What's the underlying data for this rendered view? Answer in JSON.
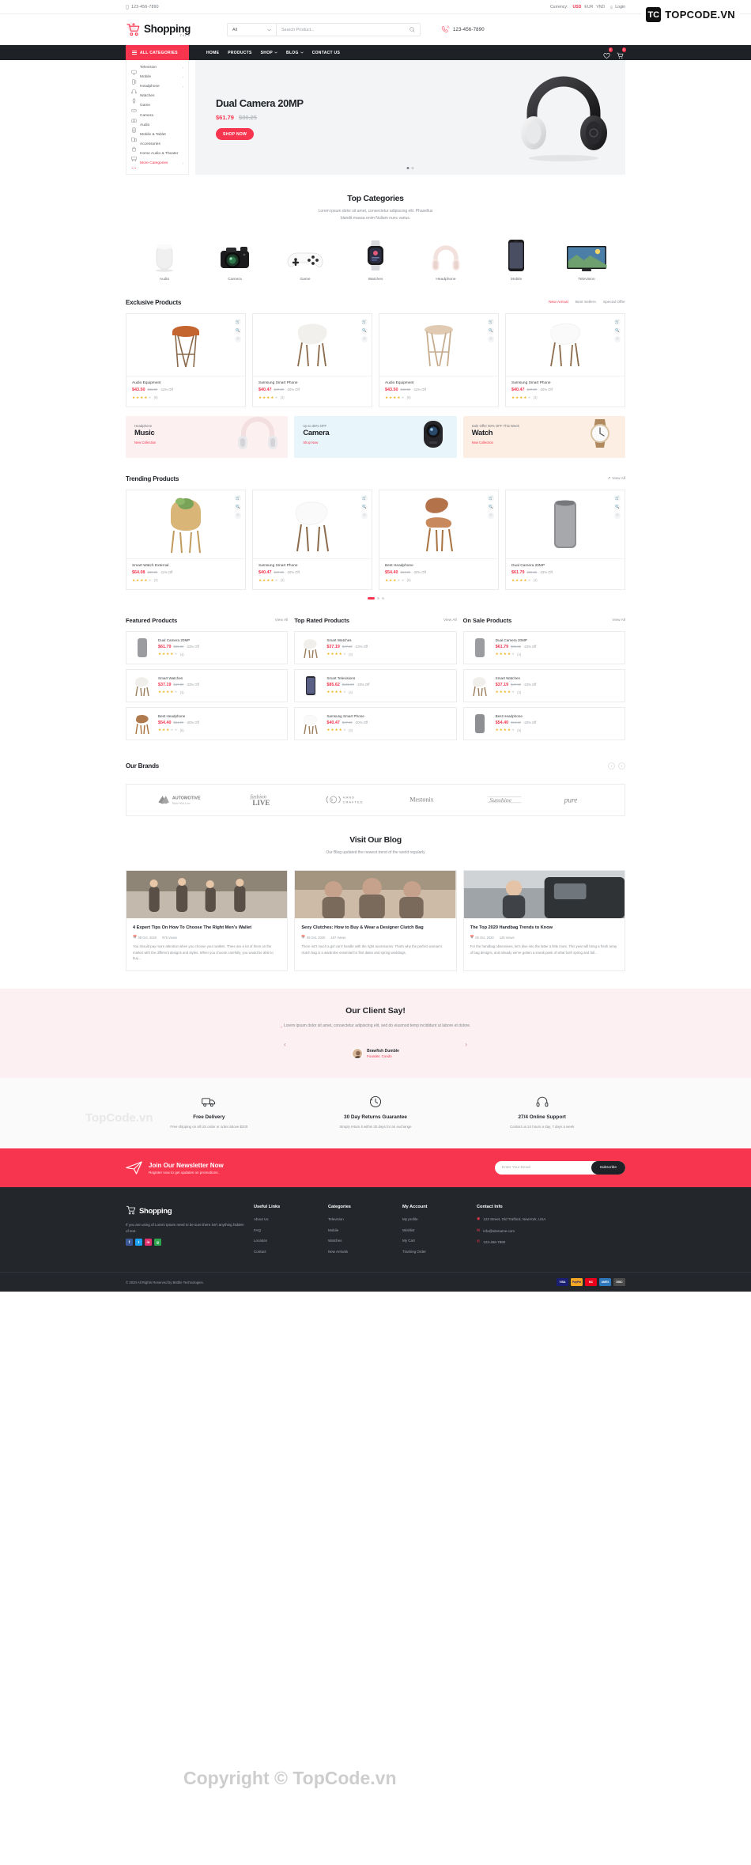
{
  "watermark": {
    "brand": "TOPCODE.VN",
    "mark": "TC",
    "mid_text": "TopCode.vn",
    "big_text": "Copyright © TopCode.vn"
  },
  "topbar": {
    "phone": "123-456-7890",
    "currency_label": "Currency:",
    "currencies": [
      "USD",
      "EUR",
      "VND"
    ],
    "active_currency": "USD",
    "login": "Login"
  },
  "header": {
    "logo": "Shopping",
    "logo_sub": "zone",
    "search_category": "All",
    "search_placeholder": "Search Product...",
    "phone": "123-456-7890"
  },
  "nav": {
    "all_categories": "ALL CATEGORIES",
    "links": [
      {
        "label": "HOME",
        "caret": false
      },
      {
        "label": "PRODUCTS",
        "caret": false
      },
      {
        "label": "SHOP",
        "caret": true
      },
      {
        "label": "BLOG",
        "caret": true
      },
      {
        "label": "CONTACT US",
        "caret": false
      }
    ],
    "wishlist_count": "0",
    "cart_count": "0"
  },
  "categories": [
    {
      "label": "Television",
      "icon": "tv-icon",
      "arrow": true
    },
    {
      "label": "Mobile",
      "icon": "mobile-icon",
      "arrow": true
    },
    {
      "label": "Headphone",
      "icon": "headphone-icon",
      "arrow": true
    },
    {
      "label": "Watches",
      "icon": "watch-icon",
      "arrow": false
    },
    {
      "label": "Game",
      "icon": "gamepad-icon",
      "arrow": false
    },
    {
      "label": "Camera",
      "icon": "camera-icon",
      "arrow": false
    },
    {
      "label": "Audio",
      "icon": "audio-icon",
      "arrow": false
    },
    {
      "label": "Mobile & Tablet",
      "icon": "tablet-icon",
      "arrow": false
    },
    {
      "label": "Accessories",
      "icon": "accessories-icon",
      "arrow": false
    },
    {
      "label": "Home Audio & Theater",
      "icon": "theater-icon",
      "arrow": false
    },
    {
      "label": "More Categories",
      "icon": "more-icon",
      "arrow": true
    }
  ],
  "hero": {
    "title": "Dual Camera 20MP",
    "price": "$61.79",
    "old_price": "$80.25",
    "cta": "SHOP NOW"
  },
  "top_categories": {
    "title": "Top Categories",
    "subtitle_line1": "Lorem ipsum dolor sit amet, consectetur adipiscing elit. Phasellus",
    "subtitle_line2": "blandit massa enim Nullam nunc varius.",
    "items": [
      {
        "label": "Audio",
        "icon": "speaker-image"
      },
      {
        "label": "Camera",
        "icon": "camera-image"
      },
      {
        "label": "Game",
        "icon": "gamepad-image"
      },
      {
        "label": "Watches",
        "icon": "smartwatch-image"
      },
      {
        "label": "Headphone",
        "icon": "headphone-image"
      },
      {
        "label": "Mobile",
        "icon": "phone-image"
      },
      {
        "label": "Television",
        "icon": "tv-image"
      }
    ]
  },
  "exclusive": {
    "title": "Exclusive Products",
    "tabs": [
      {
        "label": "New Arrival",
        "active": true
      },
      {
        "label": "Best Sellers",
        "active": false
      },
      {
        "label": "Special Offer",
        "active": false
      }
    ],
    "products": [
      {
        "name": "Audio Equipment",
        "price": "$43.50",
        "old": "$55.00",
        "off": "-13% Off",
        "rating": 4,
        "reviews": "(8)",
        "image": "bar-stool"
      },
      {
        "name": "Samsung Smart Phone",
        "price": "$40.47",
        "old": "$47.99",
        "off": "-20% Off",
        "rating": 4,
        "reviews": "(3)",
        "image": "lounge-chair"
      },
      {
        "name": "Audio Equipment",
        "price": "$43.50",
        "old": "$49.00",
        "off": "-13% Off",
        "rating": 4,
        "reviews": "(6)",
        "image": "wooden-stool"
      },
      {
        "name": "Samsung Smart Phone",
        "price": "$40.47",
        "old": "$47.99",
        "off": "-20% Off",
        "rating": 4,
        "reviews": "(3)",
        "image": "white-chair"
      }
    ]
  },
  "promos": [
    {
      "small": "Headphone",
      "big": "Music",
      "link": "New Collection",
      "theme": "pink",
      "icon": "headphone-promo"
    },
    {
      "small": "Up to 35% OFF",
      "big": "Camera",
      "link": "Shop Now",
      "theme": "blue",
      "icon": "camera-promo"
    },
    {
      "small": "Sale Offer 50% OFF This Week",
      "big": "Watch",
      "link": "New Collection",
      "theme": "orange",
      "icon": "watch-promo"
    }
  ],
  "trending": {
    "title": "Trending Products",
    "view_all": "View All",
    "products": [
      {
        "name": "Smart Watch External",
        "price": "$64.08",
        "old": "$80.00",
        "off": "-11% Off",
        "rating": 4,
        "reviews": "(2)",
        "image": "rattan-chair"
      },
      {
        "name": "Samsung Smart Phone",
        "price": "$40.47",
        "old": "$47.99",
        "off": "-20% Off",
        "rating": 4,
        "reviews": "(3)",
        "image": "white-lounge"
      },
      {
        "name": "Best Headphone",
        "price": "$54.40",
        "old": "$64.99",
        "off": "-20% Off",
        "rating": 3,
        "reviews": "(5)",
        "image": "cherner-chair"
      },
      {
        "name": "Dual Camera 20MP",
        "price": "$61.79",
        "old": "$80.25",
        "off": "-23% Off",
        "rating": 4,
        "reviews": "(4)",
        "image": "speaker"
      }
    ]
  },
  "columns": [
    {
      "title": "Featured Products",
      "view_all": "View All",
      "items": [
        {
          "name": "Dual Camera 20MP",
          "price": "$61.79",
          "old": "$80.25",
          "off": "-23% Off",
          "rating": 4,
          "reviews": "(4)",
          "image": "speaker"
        },
        {
          "name": "Smart Watches",
          "price": "$37.19",
          "old": "$47.00",
          "off": "-23% Off",
          "rating": 4,
          "reviews": "(3)",
          "image": "chair"
        },
        {
          "name": "Best Headphone",
          "price": "$54.40",
          "old": "$64.99",
          "off": "-20% Off",
          "rating": 3,
          "reviews": "(5)",
          "image": "chair2"
        }
      ]
    },
    {
      "title": "Top Rated Products",
      "view_all": "View All",
      "items": [
        {
          "name": "Smart Watches",
          "price": "$37.19",
          "old": "$47.00",
          "off": "-23% Off",
          "rating": 4,
          "reviews": "(3)",
          "image": "chair"
        },
        {
          "name": "Smart Televisions",
          "price": "$85.62",
          "old": "$102.00",
          "off": "-20% Off",
          "rating": 4,
          "reviews": "(4)",
          "image": "tv"
        },
        {
          "name": "Samsung Smart Phone",
          "price": "$40.47",
          "old": "$47.99",
          "off": "-20% Off",
          "rating": 4,
          "reviews": "(3)",
          "image": "chair3"
        }
      ]
    },
    {
      "title": "On Sale Products",
      "view_all": "View All",
      "items": [
        {
          "name": "Dual Camera 20MP",
          "price": "$61.79",
          "old": "$80.25",
          "off": "-23% Off",
          "rating": 4,
          "reviews": "(4)",
          "image": "speaker"
        },
        {
          "name": "Smart Watches",
          "price": "$37.19",
          "old": "$47.00",
          "off": "-23% Off",
          "rating": 4,
          "reviews": "(3)",
          "image": "chair"
        },
        {
          "name": "Best Headphone",
          "price": "$54.40",
          "old": "$64.99",
          "off": "-20% Off",
          "rating": 4,
          "reviews": "(5)",
          "image": "speaker2"
        }
      ]
    }
  ],
  "brands": {
    "title": "Our Brands",
    "items": [
      {
        "name": "AUTOMOTIVE",
        "sub": "Made With Love"
      },
      {
        "name": "fashion LIVE",
        "sub": ""
      },
      {
        "name": "HAND CRAFTED",
        "sub": ""
      },
      {
        "name": "Mestonix",
        "sub": ""
      },
      {
        "name": "Sunshine",
        "sub": ""
      },
      {
        "name": "pure",
        "sub": ""
      }
    ]
  },
  "blog": {
    "title": "Visit Our Blog",
    "subtitle": "Our Blog updated the newest trend of the world regularly",
    "posts": [
      {
        "title": "4 Expert Tips On How To Choose The Right Men's Wallet",
        "date": "08 Oct, 2020",
        "views": "975 Views",
        "excerpt": "You should pay more attention when you choose your wallets. There are a lot of them on the market with the different designs and styles. When you choose carefully, you would be able to buy...",
        "image": "women-walking"
      },
      {
        "title": "Sexy Clutches: How to Buy & Wear a Designer Clutch Bag",
        "date": "09 Oct, 2020",
        "views": "197 Views",
        "excerpt": "There isn't much a girl can't handle with the right accessories. That's why the perfect woman's clutch bag is a wardrobe essential for first dates and spring weddings.",
        "image": "friends-laughing"
      },
      {
        "title": "The Top 2020 Handbag Trends to Know",
        "date": "09 Oct, 2020",
        "views": "125 Views",
        "excerpt": "For the handbag obsessives, let's dive into the latter a little more. This year will bring a fresh array of bag designs, and already we've gotten a sneak peek of what both spring and fall...",
        "image": "woman-by-car"
      }
    ]
  },
  "testimonial": {
    "title": "Our Client Say!",
    "quote": "Lorem ipsum dolor sit amet, consectetur adipiscing elit, sed do eiusmod temp incididunt ut labore et dolore.",
    "name": "Brawfish Dumble",
    "role": "Founder, Condo"
  },
  "features": [
    {
      "title": "Free Delivery",
      "desc": "Free shipping on all US order or order above $200",
      "icon": "truck-icon"
    },
    {
      "title": "30 Day Returns Guarantee",
      "desc": "Simply return it within 30 days for an exchange",
      "icon": "refund-icon"
    },
    {
      "title": "27/4 Online Support",
      "desc": "Contact us 24 hours a day, 7 days a week",
      "icon": "headset-icon"
    }
  ],
  "newsletter": {
    "title": "Join Our Newsletter Now",
    "subtitle": "Register now to get updates on promotions.",
    "placeholder": "Enter Your Email",
    "button": "Subscribe"
  },
  "footer": {
    "logo": "Shopping",
    "about": "If you are using of Lorem Ipsum need to be sure there isn't anything hidden of text.",
    "columns": [
      {
        "title": "Useful Links",
        "links": [
          "About Us",
          "FAQ",
          "Location",
          "Contact"
        ]
      },
      {
        "title": "Categories",
        "links": [
          "Television",
          "Mobile",
          "Watches",
          "New Arrivals"
        ]
      },
      {
        "title": "My Account",
        "links": [
          "My profile",
          "Wishlist",
          "My Cart",
          "Tracking Order"
        ]
      }
    ],
    "contact_title": "Contact Info",
    "contact": [
      {
        "icon": "location-icon",
        "value": "123 Street, Old Trafford, NewYork, USA"
      },
      {
        "icon": "mail-icon",
        "value": "info@sitename.com"
      },
      {
        "icon": "phone-icon",
        "value": "123-456-7890"
      }
    ],
    "socials": [
      "f",
      "t",
      "in",
      "g"
    ],
    "copyright": "© 2020 All Rights Reserved by Bstble Technologies.",
    "payments": [
      "VISA",
      "PayPal",
      "MC",
      "AMEX",
      "DISC"
    ]
  }
}
